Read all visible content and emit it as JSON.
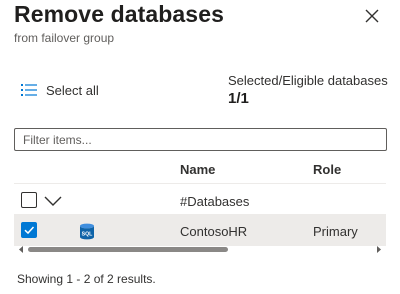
{
  "panel": {
    "title": "Remove databases",
    "subtitle": "from failover group"
  },
  "toolbar": {
    "select_all_label": "Select all"
  },
  "summary": {
    "eligible_label": "Selected/Eligible databases",
    "eligible_count": "1/1"
  },
  "filter": {
    "placeholder": "Filter items...",
    "value": ""
  },
  "table": {
    "columns": [
      "Name",
      "Role"
    ],
    "group_row": {
      "label": "#Databases",
      "checked": false,
      "expanded": true
    },
    "rows": [
      {
        "name": "ContosoHR",
        "role": "Primary",
        "checked": true,
        "icon": "sql-database-icon",
        "icon_text": "SQL"
      }
    ]
  },
  "footer": {
    "status": "Showing 1 - 2 of 2 results."
  },
  "colors": {
    "accent": "#0078d4",
    "selected_row": "#edebe9",
    "sql_icon": "#0e63a8"
  }
}
